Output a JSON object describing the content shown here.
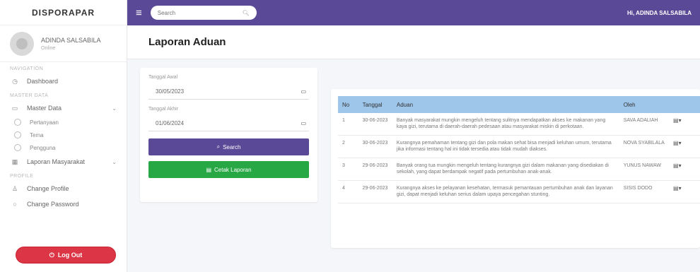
{
  "sidebar": {
    "brand": "DISPORAPAR",
    "user_name": "ADINDA SALSABILA",
    "user_status": "Online",
    "headers": [
      "Navigation",
      "Master Data",
      "Profile"
    ],
    "dashboard": "Dashboard",
    "master": "Master Data",
    "sub_items": [
      "Pertanyaan",
      "Tema",
      "Pengguna"
    ],
    "laporan": "Laporan Masyarakat",
    "change_profile": "Change Profile",
    "change_password": "Change Password",
    "logout": "Log Out"
  },
  "topbar": {
    "search_placeholder": "Search",
    "greeting": "Hi, ADINDA SALSABILA"
  },
  "page": {
    "title": "Laporan Aduan"
  },
  "filter": {
    "start_label": "Tanggal Awal",
    "start_value": "30/05/2023",
    "end_label": "Tanggal Akhir",
    "end_value": "01/06/2024",
    "search_button": "Search",
    "print_button": "Cetak Laporan"
  },
  "table": {
    "headers": [
      "No",
      "Tanggal",
      "Aduan",
      "Oleh",
      ""
    ],
    "rows": [
      {
        "no": "1",
        "date": "30-06-2023",
        "aduan": "Banyak masyarakat mungkin mengeluh tentang sulitnya mendapatkan akses ke makanan yang kaya gizi, terutama di daerah-daerah pedesaan atau masyarakat miskin di perkotaan.",
        "oleh": "SAVA ADALIAH"
      },
      {
        "no": "2",
        "date": "30-06-2023",
        "aduan": "Kurangnya pemahaman tentang gizi dan pola makan sehat bisa menjadi keluhan umum, terutama jika informasi tentang hal ini tidak tersedia atau tidak mudah diakses.",
        "oleh": "NOVA SYABILALA"
      },
      {
        "no": "3",
        "date": "29-06-2023",
        "aduan": "Banyak orang tua mungkin mengeluh tentang kurangnya gizi dalam makanan yang disediakan di sekolah, yang dapat berdampak negatif pada pertumbuhan anak-anak.",
        "oleh": "YUNUS NAWAW"
      },
      {
        "no": "4",
        "date": "29-06-2023",
        "aduan": "Kurangnya akses ke pelayanan kesehatan, termasuk pemantauan pertumbuhan anak dan layanan gizi, dapat menjadi keluhan serius dalam upaya pencegahan stunting.",
        "oleh": "SISIS DODO"
      }
    ]
  }
}
